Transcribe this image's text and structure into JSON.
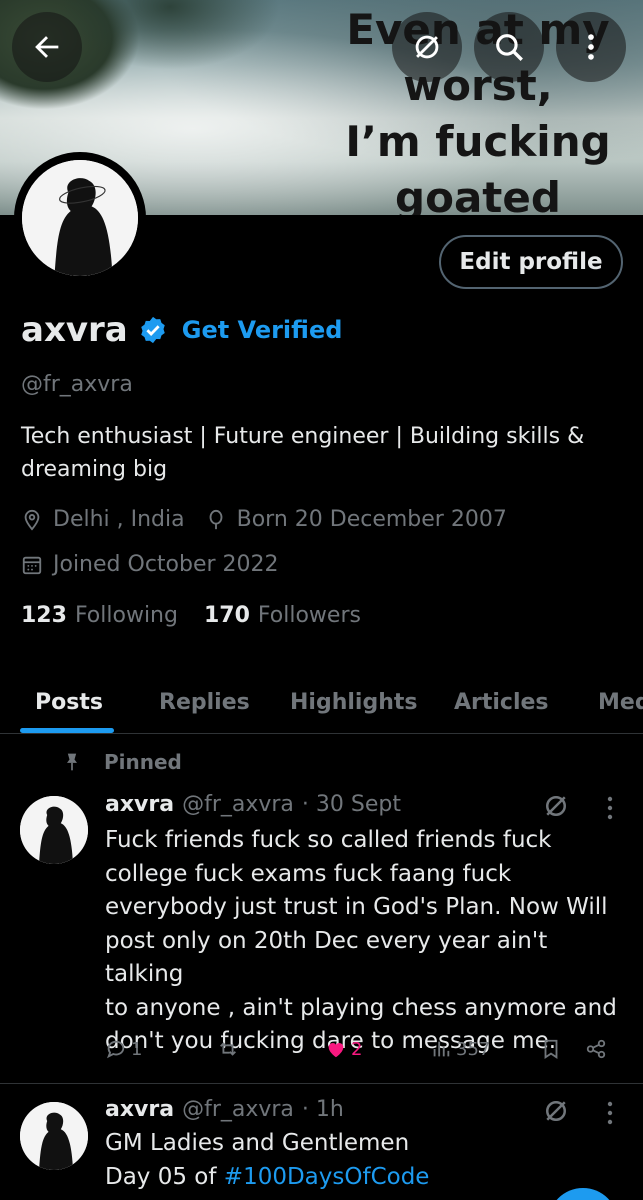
{
  "banner": {
    "text_lines": [
      "Even at my",
      "worst,",
      "I’m fucking",
      "goated"
    ]
  },
  "top_bar": {
    "back_icon": "arrow-left-icon",
    "grok_icon": "grok-icon",
    "search_icon": "search-icon",
    "more_icon": "more-vertical-icon"
  },
  "profile": {
    "edit_label": "Edit profile",
    "name": "axvra",
    "get_verified": "Get Verified",
    "handle": "@fr_axvra",
    "bio_line1": "Tech enthusiast | Future engineer | Building skills &",
    "bio_line2": "dreaming big",
    "location": "Delhi , India",
    "born": "Born 20 December 2007",
    "joined": "Joined October 2022",
    "following_count": "123",
    "following_label": "Following",
    "followers_count": "170",
    "followers_label": "Followers"
  },
  "tabs": [
    "Posts",
    "Replies",
    "Highlights",
    "Articles",
    "Media"
  ],
  "active_tab": "Posts",
  "pinned_label": "Pinned",
  "posts": [
    {
      "name": "axvra",
      "handle": "@fr_axvra",
      "time": "· 30 Sept",
      "lines": [
        "Fuck friends fuck so called friends fuck",
        "college fuck exams fuck faang fuck",
        "everybody just trust in God's Plan. Now Will",
        "post only on 20th Dec every year ain't talking",
        "to anyone , ain't playing chess anymore and",
        "don't you fucking dare to message me."
      ],
      "replies": "1",
      "reposts": "",
      "likes": "2",
      "views": "357"
    },
    {
      "name": "axvra",
      "handle": "@fr_axvra",
      "time": "· 1h",
      "line1": "GM Ladies and Gentlemen",
      "line2_prefix": "Day 05 of ",
      "hashtag": "#100DaysOfCode"
    }
  ],
  "colors": {
    "accent": "#1d9bf0",
    "like": "#f91880",
    "muted": "#71767b",
    "text": "#e7e9ea"
  }
}
